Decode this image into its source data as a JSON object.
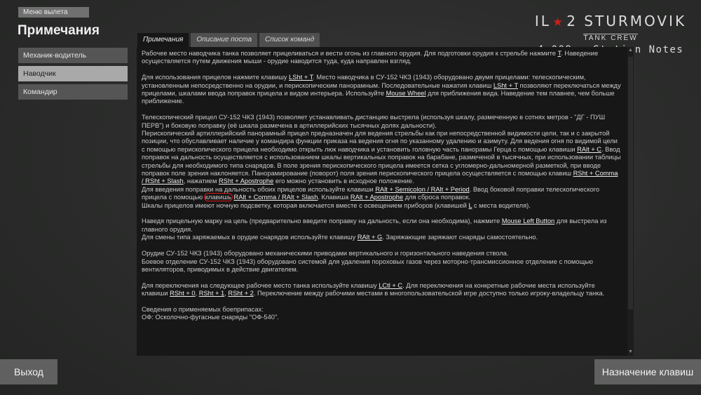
{
  "nav": {
    "back_label": "Меню вылета"
  },
  "page_title": "Примечания",
  "logo": {
    "main_left": "IL",
    "main_right": "2 STURMOVIK",
    "sub": "TANK CREW",
    "version": "4.009 : Station Notes"
  },
  "sidebar": {
    "items": [
      {
        "label": "Механик-водитель",
        "active": false
      },
      {
        "label": "Наводчик",
        "active": true
      },
      {
        "label": "Командир",
        "active": false
      }
    ]
  },
  "tabs": [
    {
      "label": "Примечания",
      "active": true
    },
    {
      "label": "Описание поста",
      "active": false
    },
    {
      "label": "Список команд",
      "active": false
    }
  ],
  "content": {
    "p1": {
      "t1": "Рабочее место наводчика танка позволяет прицеливаться и вести огонь из главного орудия. Для подготовки орудия к стрельбе нажмите ",
      "k1": "T",
      "t2": ". Наведение осуществляется путем движения мыши - орудие наводится туда, куда направлен взгляд."
    },
    "p2": {
      "t1": "Для использования прицелов нажмите клавишу ",
      "k1": "LSht + T",
      "t2": ". Место наводчика в СУ-152 ЧКЗ (1943) оборудовано двумя прицелами: телескопическим, установленным непосредственно на орудии, и перископическим панорамным. Последовательные нажатия клавиш ",
      "k2": "LSht + T",
      "t3": " позволяют переключаться между прицелами, шкалами ввода поправок прицела и видом интерьера. Используйте ",
      "k3": "Mouse Wheel",
      "t4": " для приближения вида. Наведение тем плавнее, чем больше приближение."
    },
    "p3": {
      "t1": "Телескопический прицел СУ-152 ЧКЗ (1943) позволяет устанавливать дистанцию выстрела (используя шкалу, размеченную в сотнях метров - \"ДГ - ПУШ ПЕРВ\") и боковую поправку (её шкала размечена в артиллерийских тысячных долях дальности).",
      "t2": "Перископический артиллерийский панорамный прицел предназначен для ведения стрельбы как при непосредственной видимости цели, так и с закрытой позиции, что обуславливает наличие у командира функции приказа на ведения огня по указанному удалению и азимуту. Для ведения огня по видимой цели с помощью перископического прицела необходимо открыть люк наводчика и установить головную часть панорамы Герца с помощью клавиши ",
      "k1": "RAlt + C",
      "t3": ". Ввод поправок на дальность осуществляется с использованием шкалы вертикальных поправок на барабане, размеченой в тысячных, при использовании таблицы стрельбы для необходимого типа снарядов. В поле зрения перископического прицела имеется сетка с угломерно-дальномерной разметкой, при вводе поправок поле зрения наклоняется. Панорамирование (поворот) поля зрения перископического прицела осуществляется с помощью клавиш ",
      "k2": "RSht + Comma / RSht + Slash",
      "t4": ", нажатием ",
      "k3": "RSht + Apostrophe",
      "t5": " его можно установить в исходное положение.",
      "t6": "Для введения поправки на дальность обоих прицелов используйте клавиши ",
      "k4": "RAlt + Semicolon / RAlt + Period",
      "t7": ". Ввод боковой поправки телескопического прицела с помощью ",
      "hl": "клавишь",
      "t8": " ",
      "k5": "RAlt + Comma / RAlt + Slash",
      "t9": ". Клавиша ",
      "k6": "RAlt + Apostrophe",
      "t10": " для сброса поправок.",
      "t11": "Шкалы прицелов имеют ночную подсветку, которая включается вместе с освещением приборов (клавишей ",
      "k7": "L",
      "t12": " с места водителя)."
    },
    "p4": {
      "t1": "Наведя прицельную марку на цель (предварительно введите поправку на дальность, если она необходима), нажмите ",
      "k1": "Mouse Left Button",
      "t2": " для выстрела из главного орудия.",
      "t3": "Для смены типа заряжаемых в орудие снарядов используйте клавишу ",
      "k2": "RAlt + G",
      "t4": ". Заряжающие заряжают снаряды самостоятельно."
    },
    "p5": {
      "t1": "Орудие СУ-152 ЧКЗ (1943) оборудовано механическими приводами вертикального и горизонтального наведения ствола.",
      "t2": "Боевое отделение СУ-152 ЧКЗ (1943) оборудовано системой для удаления пороховых газов через моторно-трансмиссионное отделение с помощью вентиляторов, приводимых в действие двигателем."
    },
    "p6": {
      "t1": "Для переключения на следующее рабочее место танка используйте клавишу ",
      "k1": "LCtl + C",
      "t2": ". Для переключения на конкретные рабочие места используйте клавиши ",
      "k2": "RSht + 0",
      "t3": ", ",
      "k3": "RSht + 1",
      "t4": ", ",
      "k4": "RSht + 2",
      "t5": ". Переключение между рабочими местами в многопользовательской игре доступно только игроку-владельцу танка."
    },
    "p7": {
      "t1": "Сведения о применяемых боеприпасах:",
      "t2": "ОФ: Осколочно-фугасные снаряды \"ОФ-540\"."
    }
  },
  "footer": {
    "exit_label": "Выход",
    "keys_label": "Назначение клавиш"
  },
  "colors": {
    "accent_star": "#c8201c",
    "highlight_circle": "#d01a1a",
    "panel_bg": "#171717"
  }
}
